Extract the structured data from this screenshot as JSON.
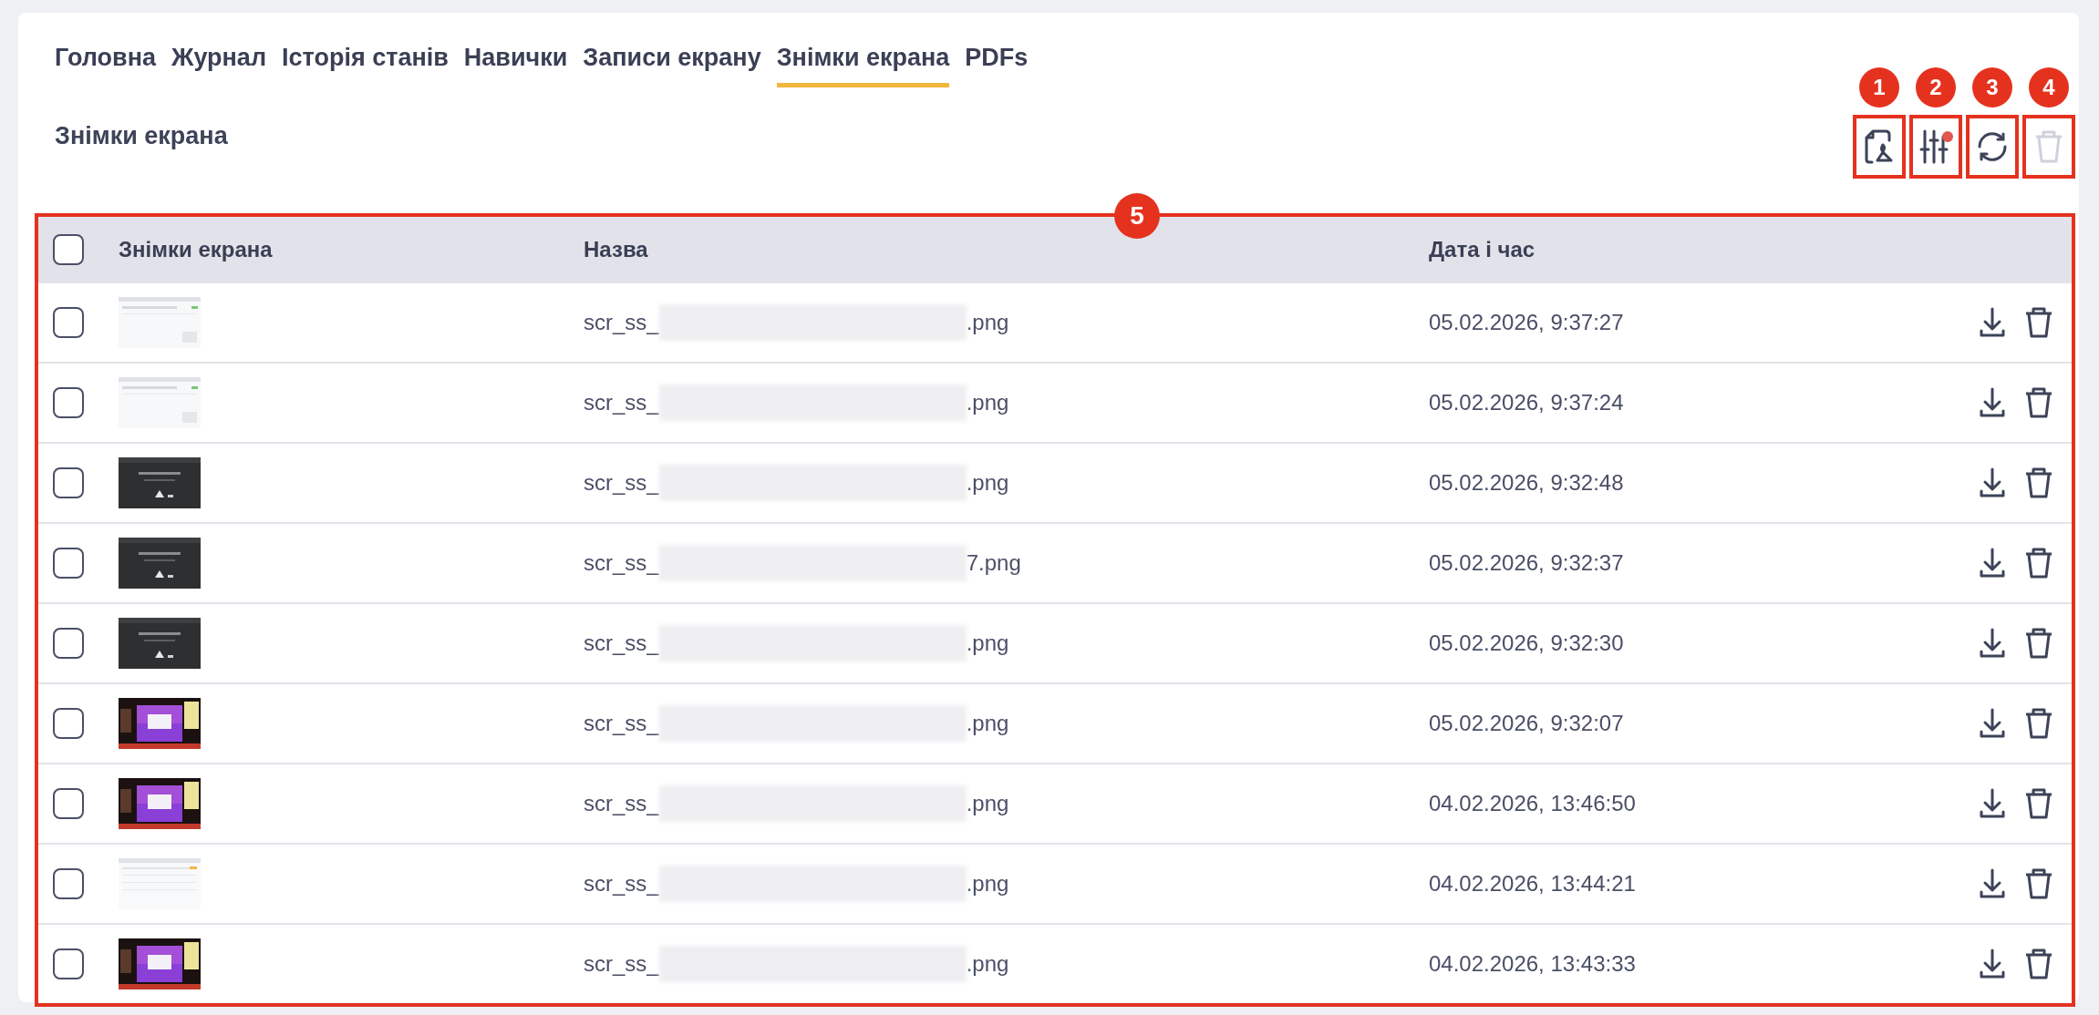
{
  "tabs": [
    {
      "label": "Головна",
      "selected": false
    },
    {
      "label": "Журнал",
      "selected": false
    },
    {
      "label": "Історія станів",
      "selected": false
    },
    {
      "label": "Навички",
      "selected": false
    },
    {
      "label": "Записи екрану",
      "selected": false
    },
    {
      "label": "Знімки екрана",
      "selected": true
    },
    {
      "label": "PDFs",
      "selected": false
    }
  ],
  "title": "Знімки екрана",
  "toolbar": [
    {
      "kind": "pdf",
      "marker": "1",
      "disabled": false,
      "badge": false
    },
    {
      "kind": "filter",
      "marker": "2",
      "disabled": false,
      "badge": true
    },
    {
      "kind": "refresh",
      "marker": "3",
      "disabled": false,
      "badge": false
    },
    {
      "kind": "delete",
      "marker": "4",
      "disabled": true,
      "badge": false
    }
  ],
  "table": {
    "marker": "5",
    "all_checked": false,
    "columns": [
      "Знімки екрана",
      "Назва",
      "Дата і час"
    ],
    "rows": [
      {
        "checked": false,
        "name_start": "scr_ss_",
        "name_end": ".png",
        "date": "05.02.2026, 9:37:27"
      },
      {
        "checked": false,
        "name_start": "scr_ss_",
        "name_end": ".png",
        "date": "05.02.2026, 9:37:24"
      },
      {
        "checked": false,
        "name_start": "scr_ss_",
        "name_end": ".png",
        "date": "05.02.2026, 9:32:48"
      },
      {
        "checked": false,
        "name_start": "scr_ss_",
        "name_end": "7.png",
        "date": "05.02.2026, 9:32:37"
      },
      {
        "checked": false,
        "name_start": "scr_ss_",
        "name_end": ".png",
        "date": "05.02.2026, 9:32:30"
      },
      {
        "checked": false,
        "name_start": "scr_ss_",
        "name_end": ".png",
        "date": "05.02.2026, 9:32:07"
      },
      {
        "checked": false,
        "name_start": "scr_ss_",
        "name_end": ".png",
        "date": "04.02.2026, 13:46:50"
      },
      {
        "checked": false,
        "name_start": "scr_ss_",
        "name_end": ".png",
        "date": "04.02.2026, 13:44:21"
      },
      {
        "checked": false,
        "name_start": "scr_ss_",
        "name_end": ".png",
        "date": "04.02.2026, 13:43:33"
      }
    ]
  }
}
